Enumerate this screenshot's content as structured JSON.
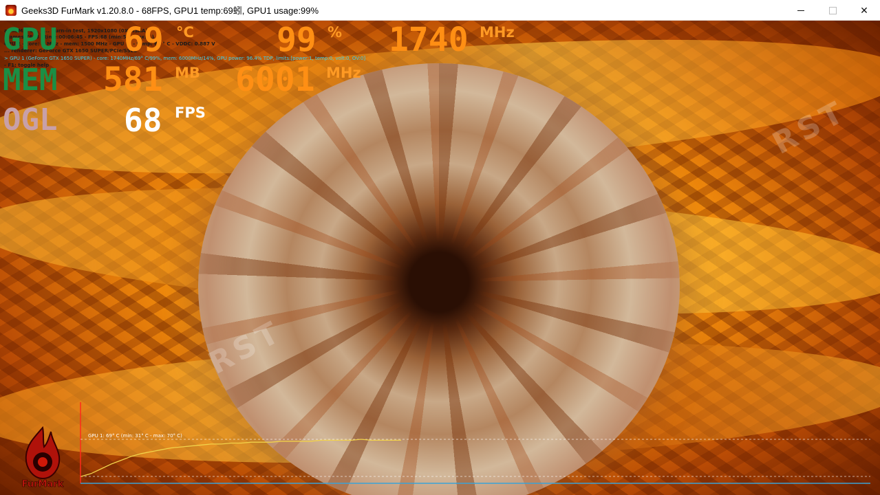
{
  "window": {
    "title": "Geeks3D FurMark v1.20.8.0 - 68FPS, GPU1 temp:69蚓, GPU1 usage:99%",
    "icon": "furmark-flame-icon",
    "minimize_glyph": "",
    "maximize_glyph": "",
    "close_glyph": "✕"
  },
  "overlay_info": {
    "lines": [
      "armaM... E... B... Burn-in test, 1920x1080 (0X MSAA)",
      "Frames:7603 - time:00:06:45 - FPS:68 (min:51, max:...)",
      "GPU 2 - core: ...MHz - mem: 1500 MHz - GPU ... - temp: 69 ° C - VDDC: 0.887 V",
      "... renderer: GeForce GTX 1650 SUPER/PCIe/SSE2",
      "> GPU 1 (GeForce GTX 1650 SUPER) - core: 1740MHz/69° C/99%, mem: 6000MHz/14%, GPU power: 96.4% TDP, limits:[power:1, temp:0, volt:0, OV:0]",
      "- F1: toggle help"
    ]
  },
  "stats": {
    "gpu": {
      "label": "GPU",
      "temp_value": "69",
      "temp_unit": "°C",
      "usage_value": "99",
      "usage_unit": "%",
      "clock_value": "1740",
      "clock_unit": "MHz"
    },
    "mem": {
      "label": "MEM",
      "used_value": "581",
      "used_unit": "MB",
      "clock_value": "6001",
      "clock_unit": "MHz"
    },
    "ogl": {
      "label": "OGL",
      "fps_value": "68",
      "fps_unit": "FPS"
    }
  },
  "watermark": {
    "text": "RST"
  },
  "logo": {
    "text": "FurMark"
  },
  "graph": {
    "title": "GPU 1: 69° C (min: 31° C - max: 70° C)",
    "series": [
      {
        "name": "GPU 1",
        "color": "#f2d24a",
        "values": [
          31,
          34,
          39,
          44,
          48,
          52,
          55,
          57,
          59,
          61,
          62,
          63,
          64,
          65,
          65,
          66,
          66,
          67,
          67,
          67,
          68,
          68,
          68,
          68,
          69,
          69,
          69,
          69,
          70,
          69,
          69,
          69,
          69
        ]
      }
    ],
    "min": 31,
    "max": 70,
    "axis_color": "#3aa3d8",
    "accent_color": "#ff2a1a"
  }
}
